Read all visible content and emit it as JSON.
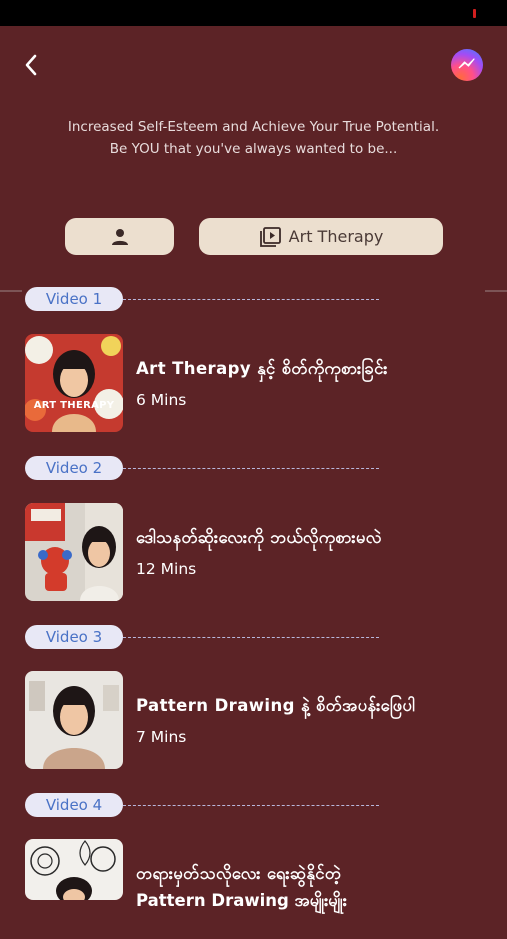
{
  "header": {
    "tagline_line1": "Increased Self-Esteem and Achieve Your True Potential.",
    "tagline_line2": "Be YOU that you've always wanted to be..."
  },
  "tabs": {
    "course_label": "Art Therapy"
  },
  "videos": [
    {
      "badge": "Video 1",
      "title": "Art Therapy နှင့် စိတ်ကိုကုစားခြင်း",
      "duration": "6 Mins",
      "thumb_text": "ART THERAPY"
    },
    {
      "badge": "Video 2",
      "title": "ဒေါသနတ်ဆိုးလေးကို ဘယ်လိုကုစားမလဲ",
      "duration": "12 Mins"
    },
    {
      "badge": "Video 3",
      "title": "Pattern Drawing နဲ့ စိတ်အပန်းဖြေပါ",
      "duration": "7 Mins"
    },
    {
      "badge": "Video 4",
      "title": "တရားမှတ်သလိုလေး ရေးဆွဲနိုင်တဲ့",
      "title_line2": "Pattern Drawing အမျိုးမျိုး"
    }
  ],
  "colors": {
    "background": "#5c2326",
    "pill": "#ecdfcf",
    "badge_bg": "#e8e8f6",
    "badge_text": "#4a72c6"
  }
}
